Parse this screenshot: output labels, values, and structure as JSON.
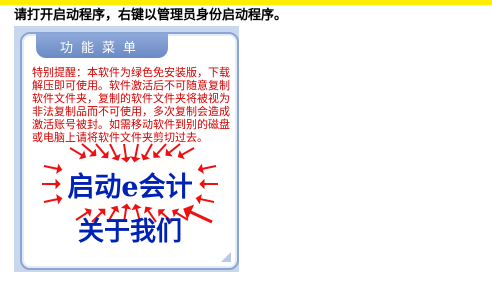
{
  "instruction": "请打开启动程序，右键以管理员身份启动程序。",
  "menu": {
    "header": "功能菜单",
    "notice": "特别提醒：本软件为绿色免安装版，下载解压即可使用。软件激活后不可随意复制软件文件夹，复制的软件文件夹将被视为非法复制品而不可使用，多次复制会造成激活账号被封。如需移动软件到别的磁盘或电脑上请将软件文件夹剪切过去。",
    "start_label": "启动e会计",
    "about_label": "关于我们"
  },
  "colors": {
    "top_bar": "#ffee00",
    "notice_text": "#d40000",
    "arrow": "#ee1111",
    "button_text": "#0022b4",
    "panel_border": "#8aa4d4"
  }
}
